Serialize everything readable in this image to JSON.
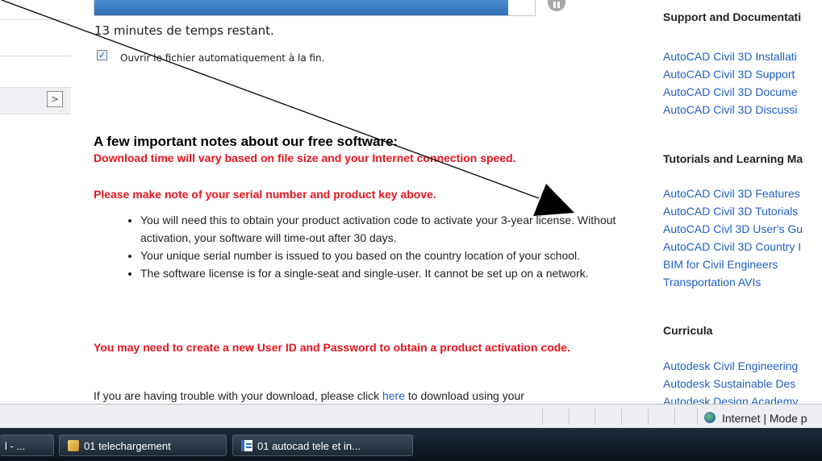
{
  "download": {
    "progress_fraction": 0.94,
    "time_remaining": "13 minutes de temps restant.",
    "auto_open_label": "Ouvrir le fichier automatiquement à la fin.",
    "auto_open_checked": true
  },
  "notes": {
    "title": "A few important notes about our free software:",
    "download_time": "Download time will vary based on file size and your Internet connection speed.",
    "serial_note": "Please make note of your serial number and product key above.",
    "bullets": [
      "You will need this to obtain your product activation code to activate your 3-year license. Without activation, your software will time-out after 30 days.",
      "Your unique serial number is issued to you based on the country location of your school.",
      "The software license is for a single-seat and single-user. It cannot be set up on a network."
    ],
    "user_id_note": "You may need to create a new User ID and Password to obtain a product activation code.",
    "trouble_prefix": "If you are having trouble with your download, please click ",
    "trouble_link": "here",
    "trouble_suffix": " to download using your"
  },
  "sidebar": {
    "sections": [
      {
        "heading": "Support and Documentati",
        "links": [
          "AutoCAD Civil 3D Installati",
          "AutoCAD Civil 3D Support",
          "AutoCAD Civil 3D Docume",
          "AutoCAD Civil 3D Discussi"
        ]
      },
      {
        "heading": "Tutorials and Learning Ma",
        "links": [
          "AutoCAD Civil 3D Features",
          "AutoCAD Civil 3D Tutorials",
          "AutoCAD Civl 3D User's Gu",
          "AutoCAD Civil 3D Country I",
          "BIM for Civil Engineers",
          "Transportation AVIs"
        ]
      },
      {
        "heading": "Curricula",
        "links": [
          "Autodesk Civil Engineering",
          "Autodesk Sustainable Des",
          "Autodesk Design Academy"
        ]
      }
    ]
  },
  "statusbar": {
    "zone_text": "Internet | Mode p"
  },
  "taskbar": {
    "items": [
      {
        "label": "l - ...",
        "icon": "window-icon"
      },
      {
        "label": "01 telechargement",
        "icon": "folder-icon"
      },
      {
        "label": "01 autocad tele et in...",
        "icon": "document-icon"
      }
    ]
  },
  "colors": {
    "warning_red": "#e8141e",
    "link_blue": "#1f5fc5",
    "progress_blue": "#2f6fb8"
  }
}
